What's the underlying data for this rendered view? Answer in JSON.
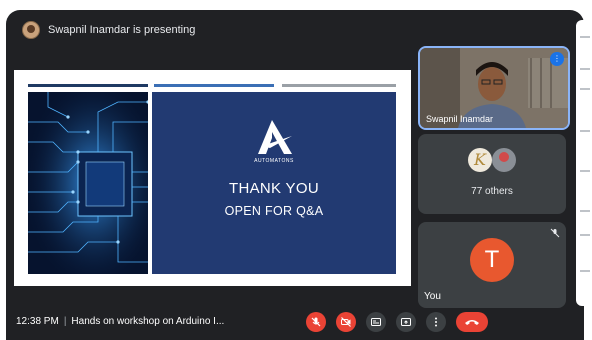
{
  "topbar": {
    "presenting_text": "Swapnil Inamdar is presenting"
  },
  "slide": {
    "logo_text": "AUTOMATONS",
    "title": "THANK YOU",
    "subtitle": "OPEN FOR Q&A"
  },
  "participants": {
    "presenter_name": "Swapnil Inamdar",
    "others_label": "77 others",
    "others_avatar_letter": "K",
    "you_initial": "T",
    "you_label": "You"
  },
  "bottombar": {
    "time": "12:38 PM",
    "separator": "|",
    "meeting_title": "Hands on workshop on Arduino I..."
  },
  "colors": {
    "background": "#202124",
    "tile": "#3c4043",
    "accent_red": "#ea4335",
    "active_speaker_border": "#8ab4f8",
    "slide_panel": "#223a72"
  },
  "icons": [
    "mic-off-icon",
    "camera-off-icon",
    "captions-icon",
    "present-icon",
    "more-options-icon",
    "end-call-icon"
  ]
}
